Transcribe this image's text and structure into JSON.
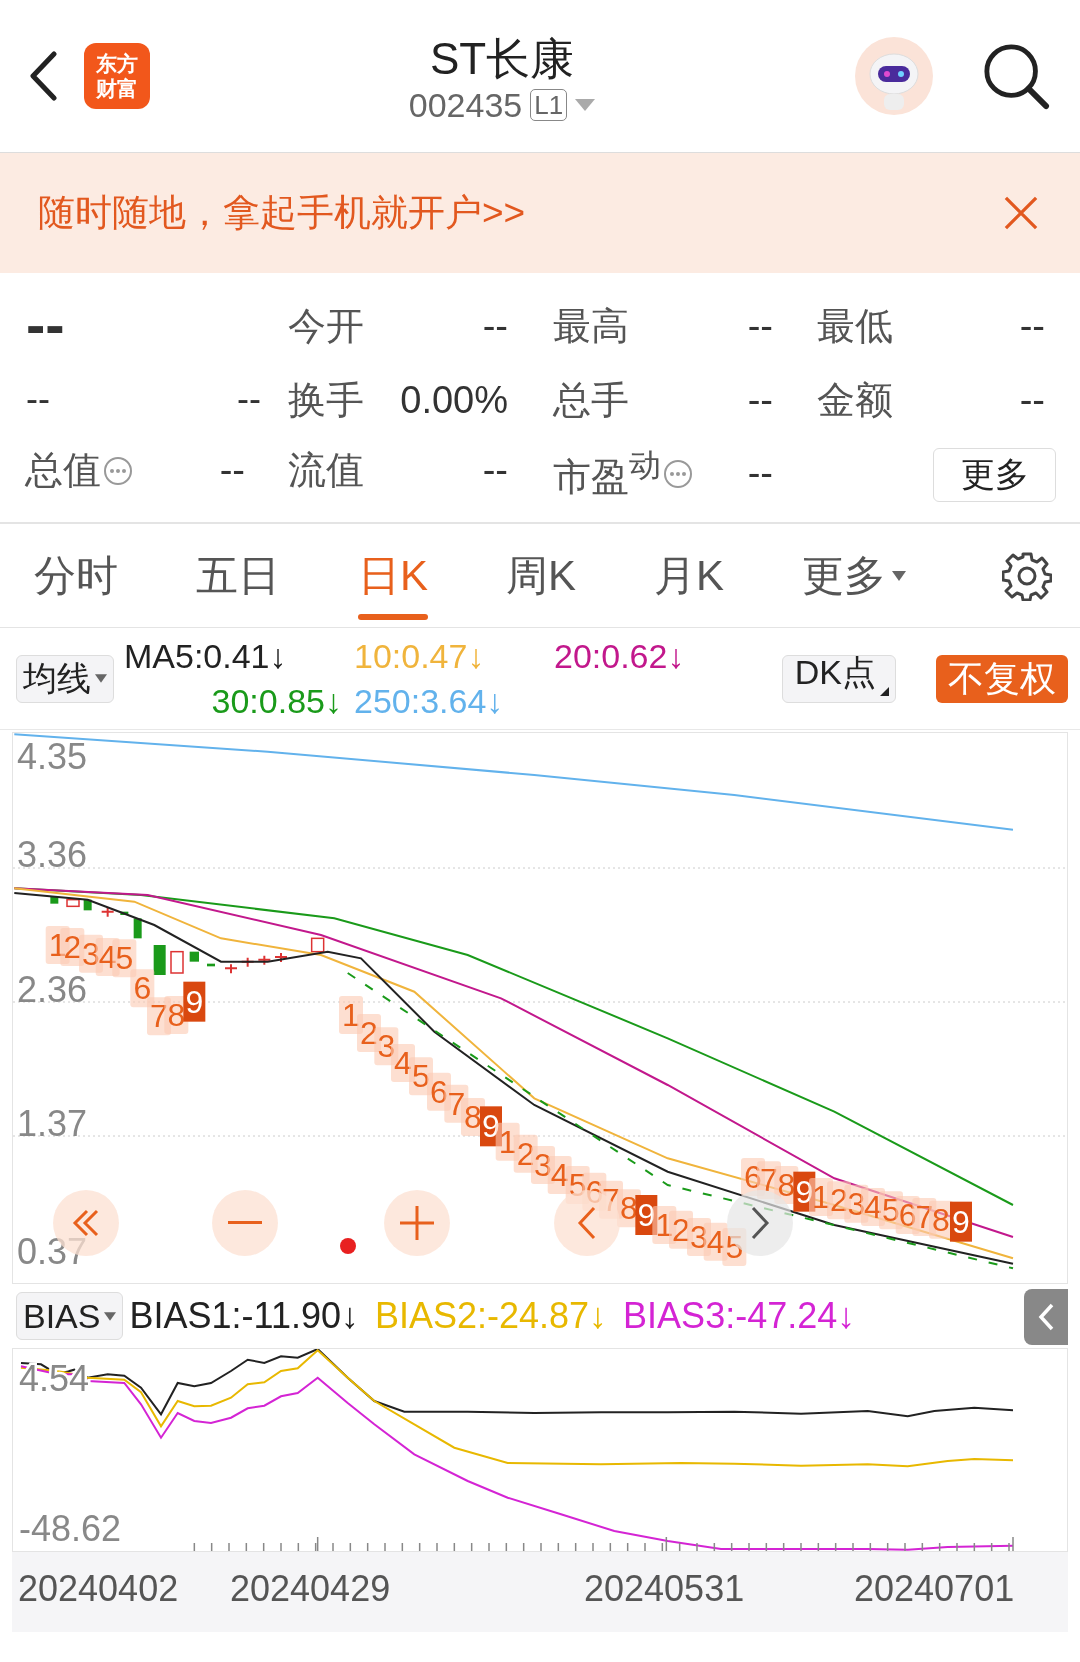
{
  "header": {
    "logo": [
      "东方",
      "财富"
    ],
    "title": "ST长康",
    "code": "002435",
    "level_badge": "L1"
  },
  "banner": {
    "text": "随时随地，拿起手机就开户>>"
  },
  "quote": {
    "price": "--",
    "change": "--",
    "change_pct": "--",
    "fields": [
      {
        "label": "今开",
        "value": "--",
        "kind": "plain"
      },
      {
        "label": "最高",
        "value": "--",
        "kind": "plain"
      },
      {
        "label": "最低",
        "value": "--",
        "kind": "plain"
      },
      {
        "label": "换手",
        "value": "0.00%",
        "kind": "plain"
      },
      {
        "label": "总手",
        "value": "--",
        "kind": "plain"
      },
      {
        "label": "金额",
        "value": "--",
        "kind": "plain"
      },
      {
        "label": "总值",
        "value": "--",
        "kind": "info"
      },
      {
        "label": "流值",
        "value": "--",
        "kind": "plain"
      },
      {
        "label": "市盈$^{动}$",
        "value": "--",
        "kind": "info"
      }
    ],
    "more_button": "更多"
  },
  "tabs": [
    {
      "label": "分时",
      "selected": false
    },
    {
      "label": "五日",
      "selected": false
    },
    {
      "label": "日K",
      "selected": true
    },
    {
      "label": "周K",
      "selected": false
    },
    {
      "label": "月K",
      "selected": false
    }
  ],
  "tabs_more": "更多",
  "ma_legend": {
    "selector": "均线",
    "items": [
      {
        "text": "MA5:0.41↓",
        "color": "#222222"
      },
      {
        "text": "10:0.47↓",
        "color": "#f0b43c"
      },
      {
        "text": "20:0.62↓",
        "color": "#c2188c"
      },
      {
        "text": "30:0.85↓",
        "color": "#1a9a1a"
      },
      {
        "text": "250:3.64↓",
        "color": "#62b2ec"
      }
    ],
    "dk_button": "DK点",
    "adjust_button": "不复权"
  },
  "main_chart": {
    "y_labels": [
      "4.35",
      "3.36",
      "2.36",
      "1.37",
      "0.37"
    ],
    "sequence": [
      {
        "text": "1",
        "kind": "count"
      },
      {
        "text": "2",
        "kind": "count"
      },
      {
        "text": "3",
        "kind": "count"
      },
      {
        "text": "4",
        "kind": "count"
      },
      {
        "text": "5",
        "kind": "count"
      },
      {
        "text": "6",
        "kind": "count"
      },
      {
        "text": "7",
        "kind": "count"
      },
      {
        "text": "8",
        "kind": "count"
      },
      {
        "text": "9",
        "kind": "signal"
      },
      {
        "text": "1",
        "kind": "count"
      },
      {
        "text": "2",
        "kind": "count"
      },
      {
        "text": "3",
        "kind": "count"
      },
      {
        "text": "4",
        "kind": "count"
      },
      {
        "text": "5",
        "kind": "count"
      },
      {
        "text": "6",
        "kind": "count"
      },
      {
        "text": "7",
        "kind": "count"
      },
      {
        "text": "8",
        "kind": "count"
      },
      {
        "text": "9",
        "kind": "signal"
      },
      {
        "text": "1",
        "kind": "count"
      },
      {
        "text": "2",
        "kind": "count"
      },
      {
        "text": "3",
        "kind": "count"
      },
      {
        "text": "4",
        "kind": "count"
      },
      {
        "text": "5",
        "kind": "count"
      },
      {
        "text": "6",
        "kind": "count"
      },
      {
        "text": "7",
        "kind": "count"
      },
      {
        "text": "8",
        "kind": "count"
      },
      {
        "text": "9",
        "kind": "signal"
      },
      {
        "text": "1",
        "kind": "count"
      },
      {
        "text": "2",
        "kind": "count"
      },
      {
        "text": "3",
        "kind": "count"
      },
      {
        "text": "4",
        "kind": "count"
      },
      {
        "text": "5",
        "kind": "count"
      },
      {
        "text": "6",
        "kind": "count"
      },
      {
        "text": "7",
        "kind": "count"
      },
      {
        "text": "8",
        "kind": "count"
      },
      {
        "text": "9",
        "kind": "signal"
      },
      {
        "text": "1",
        "kind": "count"
      },
      {
        "text": "2",
        "kind": "count"
      },
      {
        "text": "3",
        "kind": "count"
      },
      {
        "text": "4",
        "kind": "count"
      },
      {
        "text": "5",
        "kind": "count"
      },
      {
        "text": "6",
        "kind": "count"
      },
      {
        "text": "7",
        "kind": "count"
      },
      {
        "text": "8",
        "kind": "count"
      },
      {
        "text": "9",
        "kind": "signal"
      }
    ]
  },
  "bias_legend": {
    "selector": "BIAS",
    "items": [
      {
        "text": "BIAS1:-11.90↓",
        "color": "#222222"
      },
      {
        "text": "BIAS2:-24.87↓",
        "color": "#e8b800"
      },
      {
        "text": "BIAS3:-47.24↓",
        "color": "#d424d4"
      }
    ]
  },
  "bias_chart": {
    "y_labels": [
      "4.54",
      "-48.62"
    ]
  },
  "x_labels": [
    "20240402",
    "20240429",
    "20240531",
    "20240701"
  ]
}
